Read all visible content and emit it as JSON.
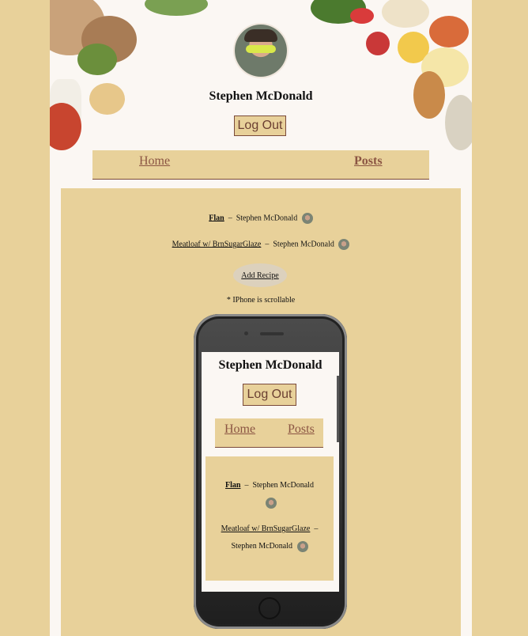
{
  "header": {
    "user_name": "Stephen McDonald",
    "logout_label": "Log Out"
  },
  "nav": {
    "home_label": "Home",
    "posts_label": "Posts"
  },
  "posts": [
    {
      "title": "Flan",
      "separator": "–",
      "author": "Stephen McDonald"
    },
    {
      "title": "Meatloaf w/ BrnSugarGlaze",
      "separator": "–",
      "author": "Stephen McDonald"
    }
  ],
  "add_recipe_label": "Add Recipe",
  "scroll_note": "* IPhone is scrollable",
  "phone_preview": {
    "user_name": "Stephen McDonald",
    "logout_label": "Log Out",
    "home_label": "Home",
    "posts_label": "Posts",
    "posts": [
      {
        "title": "Flan",
        "separator": "–",
        "author": "Stephen McDonald"
      },
      {
        "title": "Meatloaf w/ BrnSugarGlaze",
        "separator": "–",
        "author": "Stephen McDonald"
      }
    ]
  },
  "colors": {
    "background": "#e8d19a",
    "page": "#fbf7f3",
    "accent_text": "#8b5543",
    "border": "#7a4a3a"
  }
}
